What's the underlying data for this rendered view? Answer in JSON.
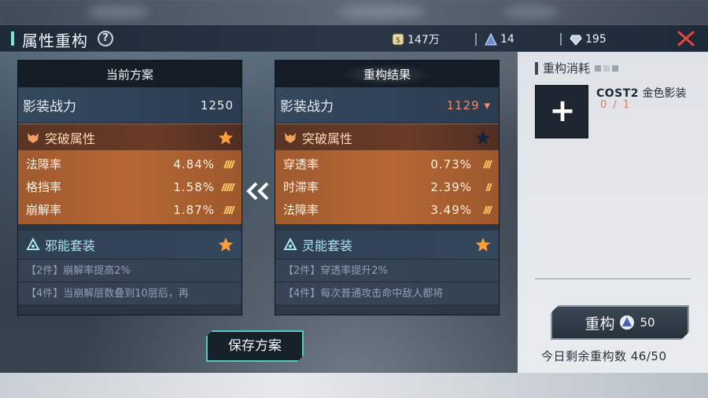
{
  "header": {
    "title": "属性重构",
    "resources": [
      {
        "icon": "gold-coin-icon",
        "value": "147万"
      },
      {
        "icon": "crystal-pyramid-icon",
        "value": "14"
      },
      {
        "icon": "diamond-icon",
        "value": "195"
      }
    ]
  },
  "current": {
    "title": "当前方案",
    "power_label": "影装战力",
    "power_value": "1250",
    "break_label": "突破属性",
    "stats": [
      {
        "name": "法障率",
        "value": "4.84%"
      },
      {
        "name": "格挡率",
        "value": "1.58%"
      },
      {
        "name": "崩解率",
        "value": "1.87%"
      }
    ],
    "suit_label": "邪能套装",
    "suit_desc": [
      "【2件】崩解率提高2%",
      "【4件】当崩解层数叠到10层后，再"
    ]
  },
  "result": {
    "title": "重构结果",
    "power_label": "影装战力",
    "power_value": "1129",
    "break_label": "突破属性",
    "stats": [
      {
        "name": "穿透率",
        "value": "0.73%"
      },
      {
        "name": "时滞率",
        "value": "2.39%"
      },
      {
        "name": "法障率",
        "value": "3.49%"
      }
    ],
    "suit_label": "灵能套装",
    "suit_desc": [
      "【2件】穿透率提升2%",
      "【4件】每次普通攻击命中敌人都将"
    ]
  },
  "save_button": "保存方案",
  "cost": {
    "heading": "重构消耗",
    "item_code": "COST2",
    "item_name": "金色影装",
    "item_count": "0 / 1"
  },
  "reconstruct": {
    "label": "重构",
    "cost": "50",
    "remaining_text": "今日剩余重构数 46/50"
  },
  "colors": {
    "accent_cyan": "#57c9c4",
    "break_orange": "#b56833",
    "down_red": "#f08a6a"
  }
}
